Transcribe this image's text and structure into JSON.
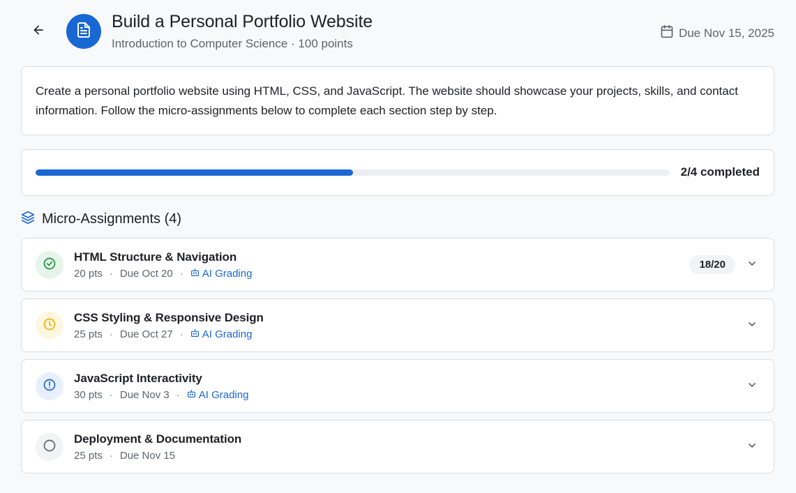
{
  "header": {
    "title": "Build a Personal Portfolio Website",
    "subtitle": "Introduction to Computer Science · 100 points",
    "due": "Due Nov 15, 2025",
    "back_icon": "arrow-left-icon",
    "doc_icon": "document-icon",
    "calendar_icon": "calendar-icon",
    "accent_color": "#1967d2"
  },
  "description": "Create a personal portfolio website using HTML, CSS, and JavaScript. The website should showcase your projects, skills, and contact information. Follow the micro-assignments below to complete each section step by step.",
  "progress": {
    "label": "2/4 completed",
    "fraction": 0.5
  },
  "section": {
    "title": "Micro-Assignments (4)",
    "icon": "layers-icon"
  },
  "assignments": [
    {
      "title": "HTML Structure & Navigation",
      "points": "20 pts",
      "due": "Due Oct 20",
      "ai_grading": "AI Grading",
      "score": "18/20",
      "status": "completed",
      "status_icon": "check-circle-icon",
      "status_color": "#1e8e3e",
      "status_bg": "#e6f4ea"
    },
    {
      "title": "CSS Styling & Responsive Design",
      "points": "25 pts",
      "due": "Due Oct 27",
      "ai_grading": "AI Grading",
      "score": "",
      "status": "pending",
      "status_icon": "clock-icon",
      "status_color": "#f9ab00",
      "status_bg": "#fef7e0"
    },
    {
      "title": "JavaScript Interactivity",
      "points": "30 pts",
      "due": "Due Nov 3",
      "ai_grading": "AI Grading",
      "score": "",
      "status": "attention",
      "status_icon": "alert-circle-icon",
      "status_color": "#1967d2",
      "status_bg": "#e8f0fe"
    },
    {
      "title": "Deployment & Documentation",
      "points": "25 pts",
      "due": "Due Nov 15",
      "ai_grading": "",
      "score": "",
      "status": "not-started",
      "status_icon": "empty-circle-icon",
      "status_color": "#5f6368",
      "status_bg": "#f1f3f4"
    }
  ]
}
